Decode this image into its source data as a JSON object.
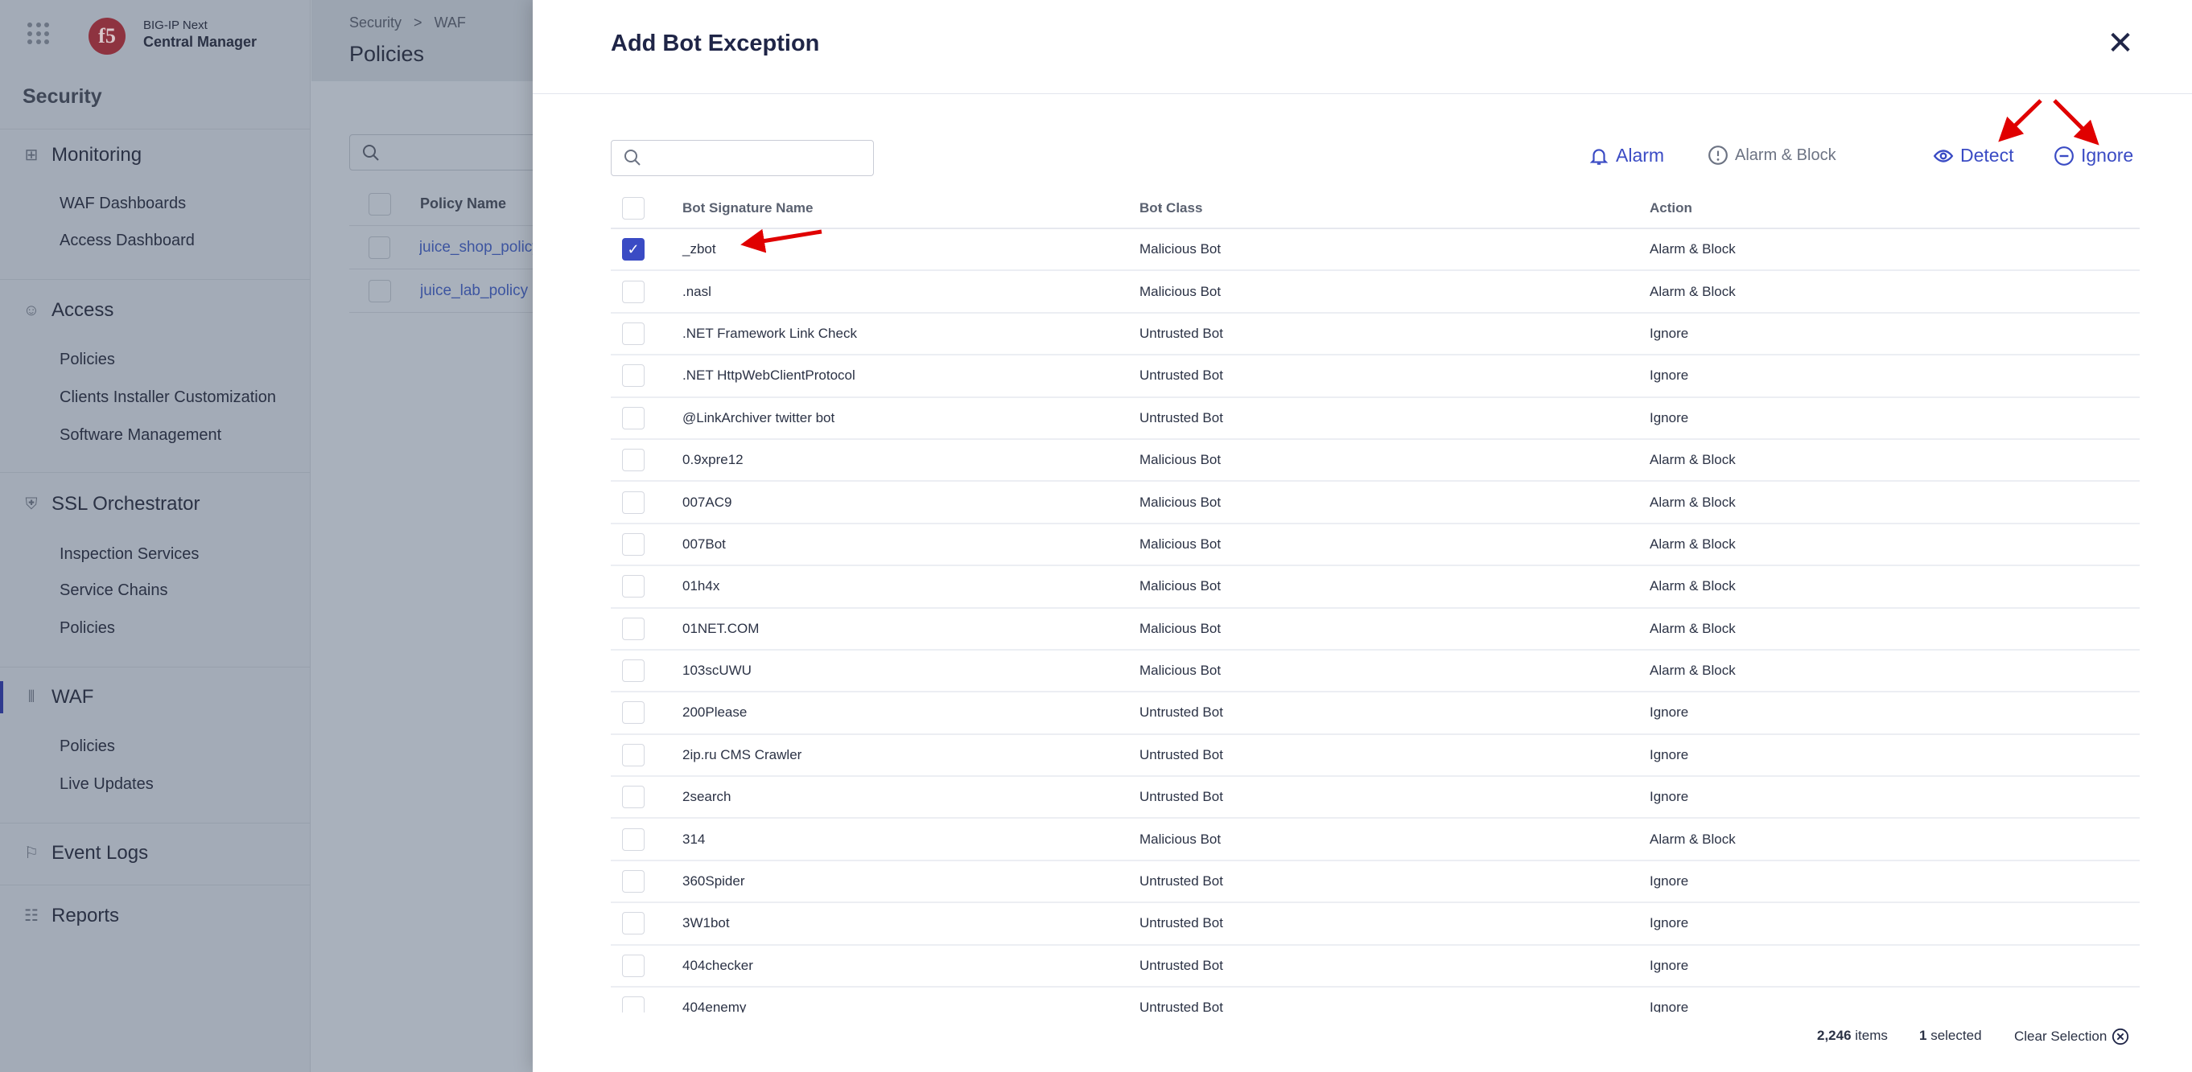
{
  "app": {
    "brand_line1": "BIG-IP Next",
    "brand_line2": "Central Manager",
    "logo": "f5"
  },
  "sidebar": {
    "title": "Security",
    "sections": [
      {
        "label": "Monitoring",
        "icon": "grid-icon",
        "items": [
          "WAF Dashboards",
          "Access Dashboard"
        ]
      },
      {
        "label": "Access",
        "icon": "users-icon",
        "items": [
          "Policies",
          "Clients Installer Customization",
          "Software Management"
        ]
      },
      {
        "label": "SSL Orchestrator",
        "icon": "shield-icon",
        "items": [
          "Inspection Services",
          "Service Chains",
          "Policies"
        ]
      },
      {
        "label": "WAF",
        "icon": "waf-icon",
        "items": [
          "Policies",
          "Live Updates"
        ],
        "active": true
      },
      {
        "label": "Event Logs",
        "icon": "flag-icon",
        "items": []
      },
      {
        "label": "Reports",
        "icon": "bar-chart-icon",
        "items": []
      }
    ]
  },
  "page": {
    "breadcrumb": [
      "Security",
      "WAF"
    ],
    "title": "Policies",
    "table_header": "Policy Name",
    "rows": [
      "juice_shop_policy",
      "juice_lab_policy"
    ]
  },
  "modal": {
    "title": "Add Bot Exception",
    "search_placeholder": "",
    "actions": {
      "alarm": "Alarm",
      "alarm_block": "Alarm & Block",
      "detect": "Detect",
      "ignore": "Ignore"
    },
    "columns": {
      "name": "Bot Signature Name",
      "class": "Bot Class",
      "action": "Action"
    },
    "rows": [
      {
        "name": "_zbot",
        "class": "Malicious Bot",
        "action": "Alarm & Block",
        "checked": true
      },
      {
        "name": ".nasl",
        "class": "Malicious Bot",
        "action": "Alarm & Block"
      },
      {
        "name": ".NET Framework Link Check",
        "class": "Untrusted Bot",
        "action": "Ignore"
      },
      {
        "name": ".NET HttpWebClientProtocol",
        "class": "Untrusted Bot",
        "action": "Ignore"
      },
      {
        "name": "@LinkArchiver twitter bot",
        "class": "Untrusted Bot",
        "action": "Ignore"
      },
      {
        "name": "0.9xpre12",
        "class": "Malicious Bot",
        "action": "Alarm & Block"
      },
      {
        "name": "007AC9",
        "class": "Malicious Bot",
        "action": "Alarm & Block"
      },
      {
        "name": "007Bot",
        "class": "Malicious Bot",
        "action": "Alarm & Block"
      },
      {
        "name": "01h4x",
        "class": "Malicious Bot",
        "action": "Alarm & Block"
      },
      {
        "name": "01NET.COM",
        "class": "Malicious Bot",
        "action": "Alarm & Block"
      },
      {
        "name": "103scUWU",
        "class": "Malicious Bot",
        "action": "Alarm & Block"
      },
      {
        "name": "200Please",
        "class": "Untrusted Bot",
        "action": "Ignore"
      },
      {
        "name": "2ip.ru CMS Crawler",
        "class": "Untrusted Bot",
        "action": "Ignore"
      },
      {
        "name": "2search",
        "class": "Untrusted Bot",
        "action": "Ignore"
      },
      {
        "name": "314",
        "class": "Malicious Bot",
        "action": "Alarm & Block"
      },
      {
        "name": "360Spider",
        "class": "Untrusted Bot",
        "action": "Ignore"
      },
      {
        "name": "3W1bot",
        "class": "Untrusted Bot",
        "action": "Ignore"
      },
      {
        "name": "404checker",
        "class": "Untrusted Bot",
        "action": "Ignore"
      },
      {
        "name": "404enemy",
        "class": "Untrusted Bot",
        "action": "Ignore"
      }
    ],
    "footer": {
      "items": "2,246",
      "items_label": "items",
      "selected": "1",
      "selected_label": "selected",
      "clear": "Clear Selection"
    },
    "colors": {
      "accent": "#3a4bc4",
      "annotation": "#e00000"
    }
  }
}
